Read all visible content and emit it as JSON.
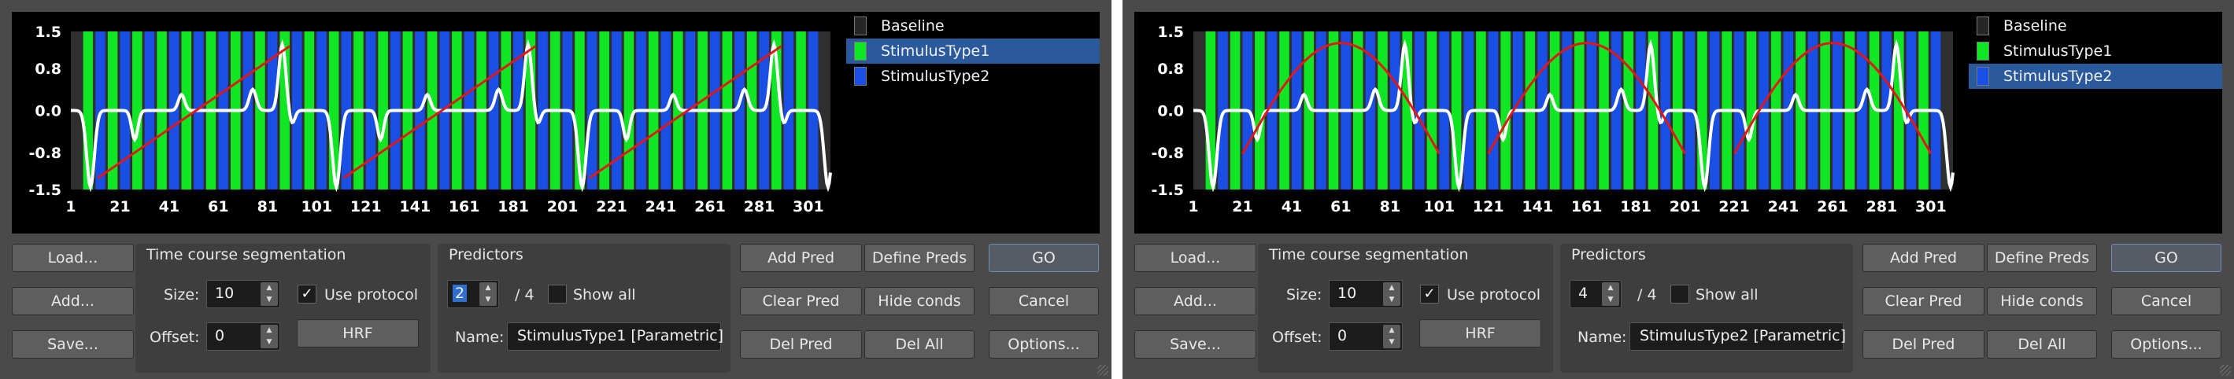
{
  "panels": [
    {
      "id": "panel-1",
      "plot": {
        "y_ticks": [
          "1.5",
          "0.8",
          "0.0",
          "-0.8",
          "-1.5"
        ],
        "y_values": [
          1.5,
          0.8,
          0.0,
          -0.8,
          -1.5
        ],
        "x_ticks": [
          "1",
          "21",
          "41",
          "61",
          "81",
          "101",
          "121",
          "141",
          "161",
          "181",
          "201",
          "221",
          "241",
          "261",
          "281",
          "301"
        ],
        "predictor_shape": "ramp",
        "colors": {
          "baseline": "#2f2f2f",
          "stim1": "#11e624",
          "stim2": "#1a4fe6",
          "signal": "#ffffff",
          "predictor": "#e01818"
        }
      },
      "legend": [
        {
          "label": "Baseline",
          "swatch": "#262626",
          "selected": false
        },
        {
          "label": "StimulusType1",
          "swatch": "#11e624",
          "selected": true
        },
        {
          "label": "StimulusType2",
          "swatch": "#1a4fe6",
          "selected": false
        }
      ],
      "buttons": {
        "load": "Load...",
        "add": "Add...",
        "save": "Save...",
        "hrf": "HRF",
        "add_pred": "Add Pred",
        "define_preds": "Define Preds",
        "go": "GO",
        "clear_pred": "Clear Pred",
        "hide_conds": "Hide conds",
        "cancel": "Cancel",
        "del_pred": "Del Pred",
        "del_all": "Del All",
        "options": "Options..."
      },
      "segmentation": {
        "title": "Time course segmentation",
        "size_label": "Size:",
        "size_value": "10",
        "use_protocol_label": "Use protocol",
        "use_protocol_checked": "✓",
        "offset_label": "Offset:",
        "offset_value": "0"
      },
      "predictors": {
        "title": "Predictors",
        "current": "2",
        "total": "/ 4",
        "show_all_label": "Show all",
        "show_all_checked": "",
        "name_label": "Name:",
        "name_value": "StimulusType1 [Parametric]"
      }
    },
    {
      "id": "panel-2",
      "plot": {
        "y_ticks": [
          "1.5",
          "0.8",
          "0.0",
          "-0.8",
          "-1.5"
        ],
        "y_values": [
          1.5,
          0.8,
          0.0,
          -0.8,
          -1.5
        ],
        "x_ticks": [
          "1",
          "21",
          "41",
          "61",
          "81",
          "101",
          "121",
          "141",
          "161",
          "181",
          "201",
          "221",
          "241",
          "261",
          "281",
          "301"
        ],
        "predictor_shape": "arch",
        "colors": {
          "baseline": "#2f2f2f",
          "stim1": "#11e624",
          "stim2": "#1a4fe6",
          "signal": "#ffffff",
          "predictor": "#e01818"
        }
      },
      "legend": [
        {
          "label": "Baseline",
          "swatch": "#262626",
          "selected": false
        },
        {
          "label": "StimulusType1",
          "swatch": "#11e624",
          "selected": false
        },
        {
          "label": "StimulusType2",
          "swatch": "#1a4fe6",
          "selected": true
        }
      ],
      "buttons": {
        "load": "Load...",
        "add": "Add...",
        "save": "Save...",
        "hrf": "HRF",
        "add_pred": "Add Pred",
        "define_preds": "Define Preds",
        "go": "GO",
        "clear_pred": "Clear Pred",
        "hide_conds": "Hide conds",
        "cancel": "Cancel",
        "del_pred": "Del Pred",
        "del_all": "Del All",
        "options": "Options..."
      },
      "segmentation": {
        "title": "Time course segmentation",
        "size_label": "Size:",
        "size_value": "10",
        "use_protocol_label": "Use protocol",
        "use_protocol_checked": "✓",
        "offset_label": "Offset:",
        "offset_value": "0"
      },
      "predictors": {
        "title": "Predictors",
        "current": "4",
        "total": "/ 4",
        "show_all_label": "Show all",
        "show_all_checked": "",
        "name_label": "Name:",
        "name_value": "StimulusType2 [Parametric]"
      }
    }
  ]
}
